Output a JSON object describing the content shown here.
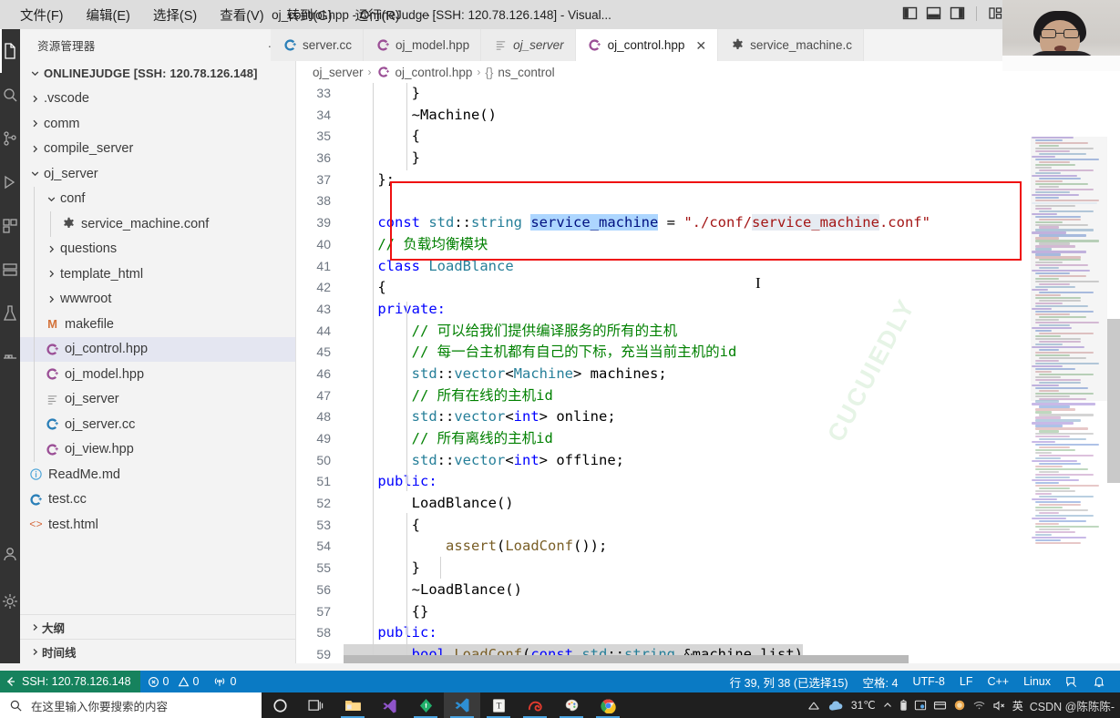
{
  "titlebar": {
    "menus": [
      "文件(F)",
      "编辑(E)",
      "选择(S)",
      "查看(V)",
      "转到(G)",
      "运行(R)"
    ],
    "more": "···",
    "window_title": "oj_control.hpp - OnlineJudge [SSH: 120.78.126.148] - Visual...",
    "minimize": "—",
    "maximize": "❐",
    "close": "✕"
  },
  "sidebar": {
    "header_title": "资源管理器",
    "header_dots": "···",
    "root": "ONLINEJUDGE [SSH: 120.78.126.148]",
    "items": [
      {
        "label": ".vscode",
        "type": "folder",
        "expanded": false,
        "depth": 1
      },
      {
        "label": "comm",
        "type": "folder",
        "expanded": false,
        "depth": 1
      },
      {
        "label": "compile_server",
        "type": "folder",
        "expanded": false,
        "depth": 1
      },
      {
        "label": "oj_server",
        "type": "folder",
        "expanded": true,
        "depth": 1
      },
      {
        "label": "conf",
        "type": "folder",
        "expanded": true,
        "depth": 2
      },
      {
        "label": "service_machine.conf",
        "type": "conf",
        "depth": 3
      },
      {
        "label": "questions",
        "type": "folder",
        "expanded": false,
        "depth": 2
      },
      {
        "label": "template_html",
        "type": "folder",
        "expanded": false,
        "depth": 2
      },
      {
        "label": "wwwroot",
        "type": "folder",
        "expanded": false,
        "depth": 2
      },
      {
        "label": "makefile",
        "type": "make",
        "depth": 2
      },
      {
        "label": "oj_control.hpp",
        "type": "cpp",
        "depth": 2,
        "selected": true
      },
      {
        "label": "oj_model.hpp",
        "type": "cpp",
        "depth": 2
      },
      {
        "label": "oj_server",
        "type": "binary",
        "depth": 2
      },
      {
        "label": "oj_server.cc",
        "type": "cc",
        "depth": 2
      },
      {
        "label": "oj_view.hpp",
        "type": "cpp",
        "depth": 2
      },
      {
        "label": "ReadMe.md",
        "type": "md",
        "depth": 1
      },
      {
        "label": "test.cc",
        "type": "cc",
        "depth": 1
      },
      {
        "label": "test.html",
        "type": "html",
        "depth": 1
      }
    ],
    "panels": [
      "大纲",
      "时间线"
    ]
  },
  "tabs": [
    {
      "label": "server.cc",
      "icon": "cc-icon",
      "active": false,
      "italic": false,
      "partial": true
    },
    {
      "label": "oj_model.hpp",
      "icon": "cpp-icon",
      "active": false,
      "italic": false
    },
    {
      "label": "oj_server",
      "icon": "binary-icon",
      "active": false,
      "italic": true
    },
    {
      "label": "oj_control.hpp",
      "icon": "cpp-icon",
      "active": true,
      "italic": false,
      "close": "✕"
    },
    {
      "label": "service_machine.c",
      "icon": "conf-icon",
      "active": false,
      "italic": false
    }
  ],
  "breadcrumb": [
    "oj_server",
    "oj_control.hpp",
    "ns_control"
  ],
  "breadcrumb_sep": "›",
  "breadcrumb_ns_prefix": "{}",
  "editor": {
    "first_line": 33,
    "watermark": "CUCUIEDLY",
    "lines": [
      {
        "n": 33,
        "tokens": [
          {
            "t": "        }",
            "c": "plain"
          }
        ]
      },
      {
        "n": 34,
        "tokens": [
          {
            "t": "        ~Machine()",
            "c": "plain"
          }
        ]
      },
      {
        "n": 35,
        "tokens": [
          {
            "t": "        {",
            "c": "plain"
          }
        ]
      },
      {
        "n": 36,
        "tokens": [
          {
            "t": "        }",
            "c": "plain"
          }
        ]
      },
      {
        "n": 37,
        "tokens": [
          {
            "t": "    };",
            "c": "plain"
          }
        ]
      },
      {
        "n": 38,
        "tokens": [
          {
            "t": "",
            "c": "plain"
          }
        ]
      },
      {
        "n": 39,
        "tokens": [
          {
            "t": "    const ",
            "c": "kw"
          },
          {
            "t": "std",
            "c": "typ"
          },
          {
            "t": "::",
            "c": "plain"
          },
          {
            "t": "string",
            "c": "typ"
          },
          {
            "t": " ",
            "c": "plain"
          },
          {
            "t": "service_machine",
            "c": "var sel-hl"
          },
          {
            "t": " = ",
            "c": "plain"
          },
          {
            "t": "\"./conf/",
            "c": "str"
          },
          {
            "t": "service_machine",
            "c": "str occ-hl"
          },
          {
            "t": ".conf\"",
            "c": "str"
          }
        ]
      },
      {
        "n": 40,
        "tokens": [
          {
            "t": "    // 负载均衡模块",
            "c": "cmt"
          }
        ]
      },
      {
        "n": 41,
        "tokens": [
          {
            "t": "    class ",
            "c": "kw"
          },
          {
            "t": "LoadBlance",
            "c": "typ"
          }
        ]
      },
      {
        "n": 42,
        "tokens": [
          {
            "t": "    {",
            "c": "plain"
          }
        ]
      },
      {
        "n": 43,
        "tokens": [
          {
            "t": "    private:",
            "c": "kw"
          }
        ]
      },
      {
        "n": 44,
        "tokens": [
          {
            "t": "        // 可以给我们提供编译服务的所有的主机",
            "c": "cmt"
          }
        ]
      },
      {
        "n": 45,
        "tokens": [
          {
            "t": "        // 每一台主机都有自己的下标，充当当前主机的id",
            "c": "cmt"
          }
        ]
      },
      {
        "n": 46,
        "tokens": [
          {
            "t": "        ",
            "c": "plain"
          },
          {
            "t": "std",
            "c": "typ"
          },
          {
            "t": "::",
            "c": "plain"
          },
          {
            "t": "vector",
            "c": "typ"
          },
          {
            "t": "<",
            "c": "plain"
          },
          {
            "t": "Machine",
            "c": "typ"
          },
          {
            "t": "> machines;",
            "c": "plain"
          }
        ]
      },
      {
        "n": 47,
        "tokens": [
          {
            "t": "        // 所有在线的主机id",
            "c": "cmt"
          }
        ]
      },
      {
        "n": 48,
        "tokens": [
          {
            "t": "        ",
            "c": "plain"
          },
          {
            "t": "std",
            "c": "typ"
          },
          {
            "t": "::",
            "c": "plain"
          },
          {
            "t": "vector",
            "c": "typ"
          },
          {
            "t": "<",
            "c": "plain"
          },
          {
            "t": "int",
            "c": "kw"
          },
          {
            "t": "> online;",
            "c": "plain"
          }
        ]
      },
      {
        "n": 49,
        "tokens": [
          {
            "t": "        // 所有离线的主机id",
            "c": "cmt"
          }
        ]
      },
      {
        "n": 50,
        "tokens": [
          {
            "t": "        ",
            "c": "plain"
          },
          {
            "t": "std",
            "c": "typ"
          },
          {
            "t": "::",
            "c": "plain"
          },
          {
            "t": "vector",
            "c": "typ"
          },
          {
            "t": "<",
            "c": "plain"
          },
          {
            "t": "int",
            "c": "kw"
          },
          {
            "t": "> offline;",
            "c": "plain"
          }
        ]
      },
      {
        "n": 51,
        "tokens": [
          {
            "t": "    public:",
            "c": "kw"
          }
        ]
      },
      {
        "n": 52,
        "tokens": [
          {
            "t": "        LoadBlance()",
            "c": "plain"
          }
        ]
      },
      {
        "n": 53,
        "tokens": [
          {
            "t": "        {",
            "c": "plain"
          }
        ]
      },
      {
        "n": 54,
        "tokens": [
          {
            "t": "            ",
            "c": "plain"
          },
          {
            "t": "assert",
            "c": "fn"
          },
          {
            "t": "(",
            "c": "plain"
          },
          {
            "t": "LoadConf",
            "c": "fn"
          },
          {
            "t": "());",
            "c": "plain"
          }
        ]
      },
      {
        "n": 55,
        "tokens": [
          {
            "t": "        }",
            "c": "plain"
          }
        ]
      },
      {
        "n": 56,
        "tokens": [
          {
            "t": "        ~LoadBlance()",
            "c": "plain"
          }
        ]
      },
      {
        "n": 57,
        "tokens": [
          {
            "t": "        {}",
            "c": "plain"
          }
        ]
      },
      {
        "n": 58,
        "tokens": [
          {
            "t": "    public:",
            "c": "kw"
          }
        ]
      },
      {
        "n": 59,
        "current": true,
        "tokens": [
          {
            "t": "        ",
            "c": "plain"
          },
          {
            "t": "bool ",
            "c": "kw"
          },
          {
            "t": "LoadConf",
            "c": "fn"
          },
          {
            "t": "(",
            "c": "plain"
          },
          {
            "t": "const ",
            "c": "kw"
          },
          {
            "t": "std",
            "c": "typ"
          },
          {
            "t": "::",
            "c": "plain"
          },
          {
            "t": "string",
            "c": "typ"
          },
          {
            "t": " &machine_list)",
            "c": "plain"
          }
        ]
      }
    ],
    "annotation_color": "#ef1010"
  },
  "statusbar": {
    "remote": "SSH: 120.78.126.148",
    "errors": "0",
    "warnings": "0",
    "ports": "0",
    "cursor": "行 39, 列 38 (已选择15)",
    "spaces": "空格: 4",
    "encoding": "UTF-8",
    "eol": "LF",
    "language": "C++",
    "platform": "Linux",
    "bg": "#0a7ac4",
    "remote_bg": "#16825d"
  },
  "taskbar": {
    "search_placeholder": "在这里输入你要搜索的内容",
    "temperature": "31℃",
    "ime": "英",
    "watermark": "CSDN @陈陈陈-",
    "icons": [
      "cortana-icon",
      "task-view-icon",
      "file-explorer-icon",
      "visual-studio-icon",
      "typora-icon",
      "vscode-icon",
      "t-note-icon",
      "snail-icon",
      "paint-icon",
      "chrome-icon"
    ],
    "tray": [
      "onedrive-icon",
      "weather-icon",
      "chevron-up-icon",
      "battery-icon",
      "screenshot-icon",
      "folder-tray-icon",
      "shield-icon",
      "wifi-icon",
      "mute-icon"
    ]
  }
}
